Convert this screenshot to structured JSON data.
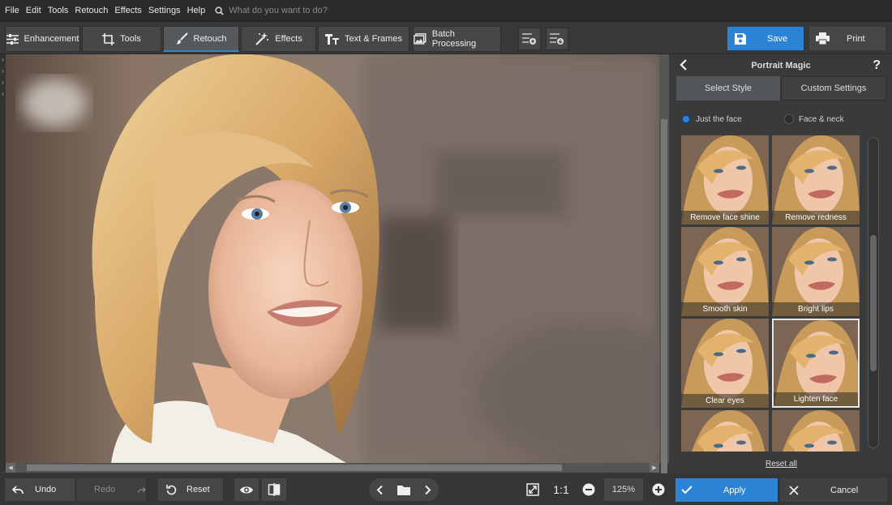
{
  "menu": {
    "items": [
      "File",
      "Edit",
      "Tools",
      "Retouch",
      "Effects",
      "Settings",
      "Help"
    ],
    "search_placeholder": "What do you want to do?"
  },
  "tabs": [
    {
      "label": "Enhancement"
    },
    {
      "label": "Tools"
    },
    {
      "label": "Retouch",
      "active": true
    },
    {
      "label": "Effects"
    },
    {
      "label": "Text & Frames"
    },
    {
      "label": "Batch Processing"
    }
  ],
  "actions": {
    "save_label": "Save",
    "print_label": "Print"
  },
  "panel": {
    "title": "Portrait Magic",
    "help": "?",
    "tab_active": "Select Style",
    "tab_inactive": "Custom Settings",
    "radio_face": "Just the face",
    "radio_neck": "Face & neck",
    "reset_all": "Reset all",
    "styles": [
      {
        "label": "Remove face shine"
      },
      {
        "label": "Remove redness"
      },
      {
        "label": "Smooth skin"
      },
      {
        "label": "Bright lips"
      },
      {
        "label": "Clear eyes"
      },
      {
        "label": "Lighten face",
        "selected": true
      },
      {
        "label": ""
      },
      {
        "label": ""
      }
    ]
  },
  "bottom": {
    "undo": "Undo",
    "redo": "Redo",
    "reset": "Reset",
    "ratio": "1:1",
    "zoom": "125%",
    "apply": "Apply",
    "cancel": "Cancel"
  },
  "colors": {
    "accent": "#2a83d4",
    "panel_bg": "#3a3a3a",
    "menubar_bg": "#2b2b2b"
  }
}
